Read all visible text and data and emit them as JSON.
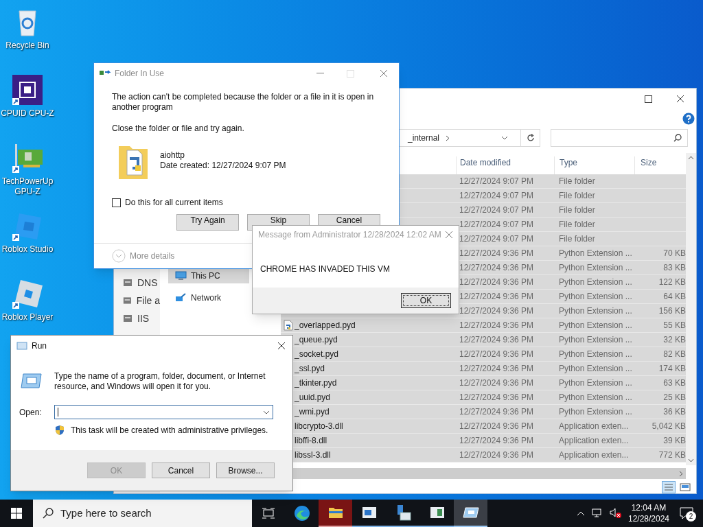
{
  "desktop_icons": [
    {
      "label": "Recycle Bin",
      "kind": "bin"
    },
    {
      "label": "CPUID CPU-Z",
      "kind": "chip"
    },
    {
      "label": "TechPowerUp GPU-Z",
      "kind": "card"
    },
    {
      "label": "Roblox Studio",
      "kind": "studio"
    },
    {
      "label": "Roblox Player",
      "kind": "player"
    }
  ],
  "explorer": {
    "address": "_internal",
    "columns": [
      "Date modified",
      "Type",
      "Size"
    ],
    "server_pane": [
      "DNS",
      "File a",
      "IIS"
    ],
    "nav": [
      {
        "label": "This PC",
        "selected": true
      },
      {
        "label": "Network",
        "selected": false
      }
    ],
    "rows": [
      {
        "date": "12/27/2024 9:07 PM",
        "type": "File folder",
        "selected": true
      },
      {
        "date": "12/27/2024 9:07 PM",
        "type": "File folder",
        "selected": true
      },
      {
        "date": "12/27/2024 9:07 PM",
        "type": "File folder",
        "selected": true
      },
      {
        "date": "12/27/2024 9:07 PM",
        "type": "File folder",
        "selected": true
      },
      {
        "date": "12/27/2024 9:07 PM",
        "type": "File folder",
        "selected": true
      },
      {
        "date": "12/27/2024 9:36 PM",
        "type": "Python Extension ...",
        "size": "70 KB",
        "selected": true
      },
      {
        "date": "12/27/2024 9:36 PM",
        "type": "Python Extension ...",
        "size": "83 KB",
        "selected": true
      },
      {
        "date": "12/27/2024 9:36 PM",
        "type": "Python Extension ...",
        "size": "122 KB",
        "selected": true
      },
      {
        "date": "12/27/2024 9:36 PM",
        "type": "Python Extension ...",
        "size": "64 KB",
        "selected": true
      },
      {
        "date": "12/27/2024 9:36 PM",
        "type": "Python Extension ...",
        "size": "156 KB",
        "selected": true
      },
      {
        "name": "_overlapped.pyd",
        "kind": "pyd",
        "date": "12/27/2024 9:36 PM",
        "type": "Python Extension ...",
        "size": "55 KB",
        "selected": true
      },
      {
        "name": "_queue.pyd",
        "date": "12/27/2024 9:36 PM",
        "type": "Python Extension ...",
        "size": "32 KB",
        "selected": true
      },
      {
        "name": "_socket.pyd",
        "date": "12/27/2024 9:36 PM",
        "type": "Python Extension ...",
        "size": "82 KB",
        "selected": true
      },
      {
        "name": "_ssl.pyd",
        "date": "12/27/2024 9:36 PM",
        "type": "Python Extension ...",
        "size": "174 KB",
        "selected": true
      },
      {
        "name": "_tkinter.pyd",
        "date": "12/27/2024 9:36 PM",
        "type": "Python Extension ...",
        "size": "63 KB",
        "selected": true
      },
      {
        "name": "_uuid.pyd",
        "date": "12/27/2024 9:36 PM",
        "type": "Python Extension ...",
        "size": "25 KB",
        "selected": true
      },
      {
        "name": "_wmi.pyd",
        "date": "12/27/2024 9:36 PM",
        "type": "Python Extension ...",
        "size": "36 KB",
        "selected": true
      },
      {
        "name": "libcrypto-3.dll",
        "date": "12/27/2024 9:36 PM",
        "type": "Application exten...",
        "size": "5,042 KB",
        "selected": true
      },
      {
        "name": "libffi-8.dll",
        "date": "12/27/2024 9:36 PM",
        "type": "Application exten...",
        "size": "39 KB",
        "selected": true
      },
      {
        "name": "libssl-3.dll",
        "date": "12/27/2024 9:36 PM",
        "type": "Application exten...",
        "size": "772 KB",
        "selected": true
      }
    ]
  },
  "folder_in_use": {
    "title": "Folder In Use",
    "message": "The action can't be completed because the folder or a file in it is open in another program",
    "instruction": "Close the folder or file and try again.",
    "item_name": "aiohttp",
    "item_date": "Date created: 12/27/2024 9:07 PM",
    "checkbox": {
      "label": "Do this for all current items",
      "checked": false
    },
    "buttons": [
      "Try Again",
      "Skip",
      "Cancel"
    ],
    "more_details": "More details"
  },
  "message_box": {
    "title": "Message from Administrator 12/28/2024 12:02 AM",
    "text": "CHROME HAS INVADED THIS VM",
    "button": "OK"
  },
  "run": {
    "title": "Run",
    "description": "Type the name of a program, folder, document, or Internet resource, and Windows will open it for you.",
    "open_label": "Open:",
    "admin_note": "This task will be created with administrative privileges.",
    "buttons": [
      {
        "label": "OK",
        "disabled": true
      },
      {
        "label": "Cancel",
        "disabled": false
      },
      {
        "label": "Browse...",
        "disabled": false
      }
    ]
  },
  "taskbar": {
    "search_placeholder": "Type here to search",
    "time": "12:04 AM",
    "date": "12/28/2024",
    "notifications": "2"
  }
}
